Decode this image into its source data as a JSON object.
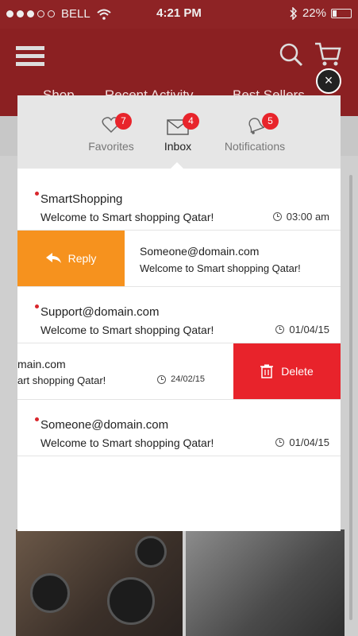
{
  "status_bar": {
    "carrier": "BELL",
    "time": "4:21 PM",
    "battery": "22%"
  },
  "app": {
    "tabs": [
      "Shop",
      "Recent Activity",
      "Best Sellers"
    ]
  },
  "colors": {
    "brand": "#8b2022",
    "reply": "#f6921e",
    "delete": "#e8232b",
    "badge": "#e8242b"
  },
  "tabs": [
    {
      "label": "Favorites",
      "icon": "heart-icon",
      "badge": "7"
    },
    {
      "label": "Inbox",
      "icon": "envelope-icon",
      "badge": "4"
    },
    {
      "label": "Notifications",
      "icon": "bell-icon",
      "badge": "5"
    }
  ],
  "messages": [
    {
      "from": "SmartShopping",
      "text": "Welcome to Smart shopping Qatar!",
      "time": "03:00 am"
    },
    {
      "from": "Someone@domain.com",
      "text": "Welcome to Smart shopping Qatar!",
      "action": "Reply"
    },
    {
      "from": "Support@domain.com",
      "text": "Welcome to Smart shopping Qatar!",
      "time": "01/04/15"
    },
    {
      "from": "main.com",
      "text": "art shopping Qatar!",
      "time": "24/02/15",
      "action": "Delete"
    },
    {
      "from": "Someone@domain.com",
      "text": "Welcome to Smart shopping Qatar!",
      "time": "01/04/15"
    }
  ],
  "close_label": "×"
}
